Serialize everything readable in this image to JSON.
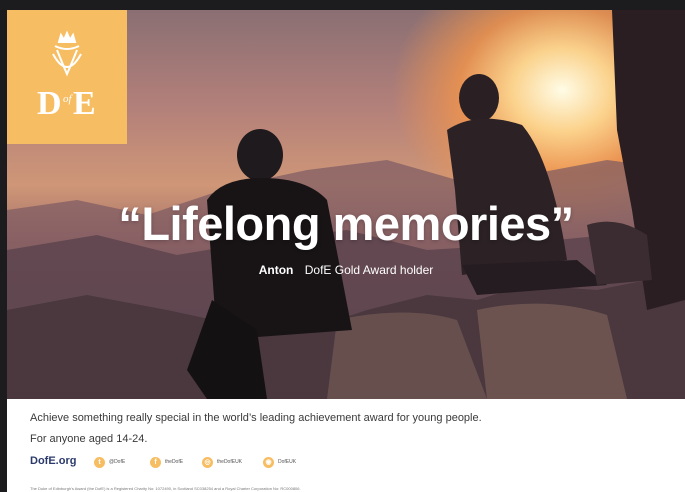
{
  "logo": {
    "text": "DofE"
  },
  "headline": {
    "quote": "“Lifelong memories”"
  },
  "attribution": {
    "name": "Anton",
    "title": "DofE Gold Award holder"
  },
  "footer": {
    "tagline": "Achieve something really special in the world’s leading achievement award for young people.",
    "age_line": "For anyone aged 14-24.",
    "site": "DofE.org",
    "social": [
      {
        "icon": "twitter-icon",
        "label": "@DofE"
      },
      {
        "icon": "facebook-icon",
        "label": "theDofE"
      },
      {
        "icon": "instagram-icon",
        "label": "theDofEUK"
      },
      {
        "icon": "other-social-icon",
        "label": "DofEUK"
      }
    ],
    "legal": "The Duke of Edinburgh's Award (the DofE) is a Registered Charity No: 1072490, in Scotland SC038254 and a Royal Charter Corporation No: RC000806."
  },
  "colors": {
    "brand_yellow": "#f7bd62",
    "site_navy": "#2b3a6b",
    "background": "#1c1c1e"
  }
}
